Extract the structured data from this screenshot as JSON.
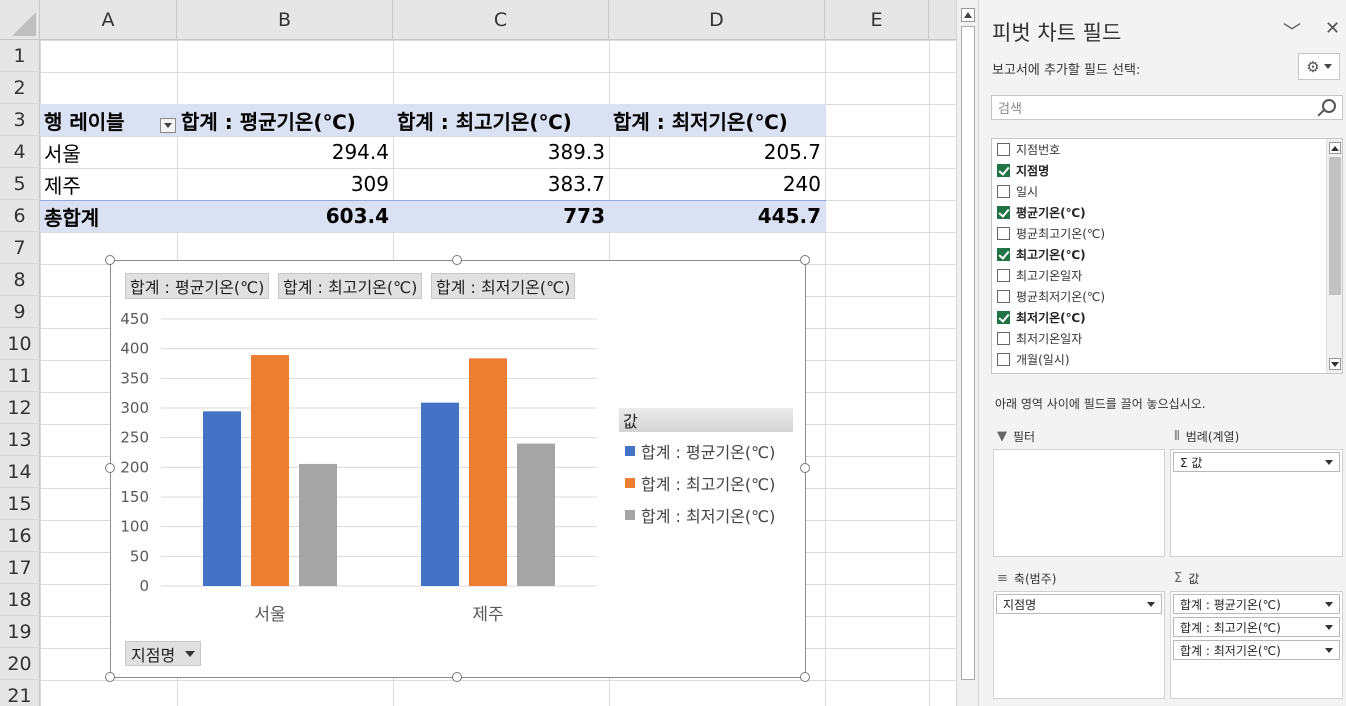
{
  "sheet": {
    "columns": [
      "A",
      "B",
      "C",
      "D",
      "E"
    ],
    "rows": [
      "1",
      "2",
      "3",
      "4",
      "5",
      "6",
      "7",
      "8",
      "9",
      "10",
      "11",
      "12",
      "13",
      "14",
      "15",
      "16",
      "17",
      "18",
      "19",
      "20",
      "21"
    ],
    "pivot": {
      "headers": [
        "행 레이블",
        "합계 : 평균기온(℃)",
        "합계 : 최고기온(℃)",
        "합계 : 최저기온(℃)"
      ],
      "rows": [
        {
          "label": "서울",
          "values": [
            "294.4",
            "389.3",
            "205.7"
          ]
        },
        {
          "label": "제주",
          "values": [
            "309",
            "383.7",
            "240"
          ]
        }
      ],
      "total": {
        "label": "총합계",
        "values": [
          "603.4",
          "773",
          "445.7"
        ]
      }
    }
  },
  "chart_data": {
    "type": "bar",
    "categories": [
      "서울",
      "제주"
    ],
    "series": [
      {
        "name": "합계 : 평균기온(℃)",
        "values": [
          294.4,
          309
        ],
        "color": "#4472c4"
      },
      {
        "name": "합계 : 최고기온(℃)",
        "values": [
          389.3,
          383.7
        ],
        "color": "#ed7d31"
      },
      {
        "name": "합계 : 최저기온(℃)",
        "values": [
          205.7,
          240
        ],
        "color": "#a5a5a5"
      }
    ],
    "ylim": [
      0,
      450
    ],
    "yticks": [
      "0",
      "50",
      "100",
      "150",
      "200",
      "250",
      "300",
      "350",
      "400",
      "450"
    ],
    "grid": true,
    "legend_title": "값",
    "legend_position": "right",
    "axis_field_button": "지점명",
    "value_field_buttons": [
      "합계 : 평균기온(℃)",
      "합계 : 최고기온(℃)",
      "합계 : 최저기온(℃)"
    ]
  },
  "pane": {
    "title": "피벗 차트 필드",
    "subtitle": "보고서에 추가할 필드 선택:",
    "search_placeholder": "검색",
    "fields": [
      {
        "label": "지점번호",
        "checked": false
      },
      {
        "label": "지점명",
        "checked": true
      },
      {
        "label": "일시",
        "checked": false
      },
      {
        "label": "평균기온(℃)",
        "checked": true
      },
      {
        "label": "평균최고기온(℃)",
        "checked": false
      },
      {
        "label": "최고기온(℃)",
        "checked": true
      },
      {
        "label": "최고기온일자",
        "checked": false
      },
      {
        "label": "평균최저기온(℃)",
        "checked": false
      },
      {
        "label": "최저기온(℃)",
        "checked": true
      },
      {
        "label": "최저기온일자",
        "checked": false
      },
      {
        "label": "개월(일시)",
        "checked": false
      }
    ],
    "hint": "아래 영역 사이에 필드를 끌어 놓으십시오.",
    "areas": {
      "filter": {
        "label": "필터",
        "items": []
      },
      "legend": {
        "label": "범례(계열)",
        "items": [
          "Σ 값"
        ]
      },
      "axis": {
        "label": "축(범주)",
        "items": [
          "지점명"
        ]
      },
      "values": {
        "label": "값",
        "items": [
          "합계 : 평균기온(℃)",
          "합계 : 최고기온(℃)",
          "합계 : 최저기온(℃)"
        ]
      }
    }
  }
}
